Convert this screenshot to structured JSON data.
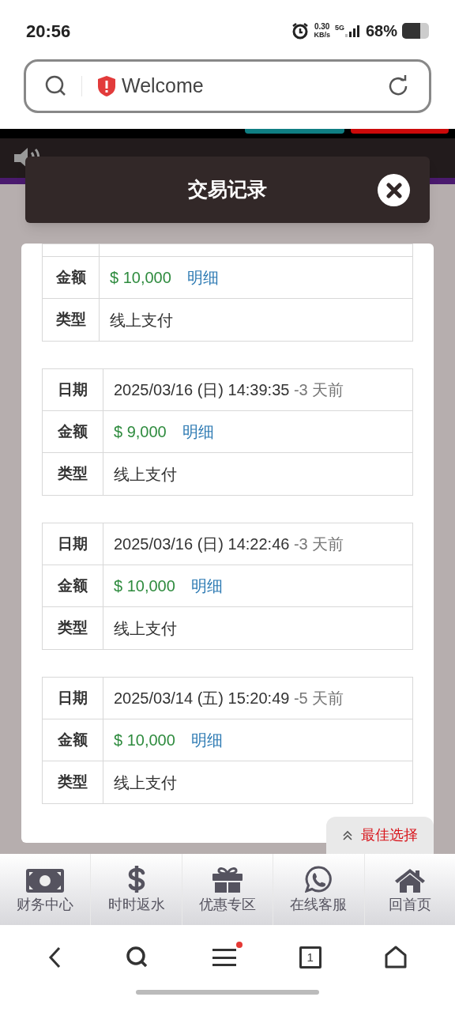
{
  "status_bar": {
    "time": "20:56",
    "speed": "0.30",
    "speed_unit": "KB/s",
    "network": "5G",
    "battery": "68%"
  },
  "address_bar": {
    "title": "Welcome"
  },
  "dialog": {
    "title": "交易记录"
  },
  "records": [
    {
      "partial": true,
      "rows": [
        {
          "kind": "amount",
          "label": "金额",
          "amount": "$ 10,000",
          "link": "明细"
        },
        {
          "kind": "text",
          "label": "类型",
          "value": "线上支付"
        }
      ]
    },
    {
      "partial": false,
      "rows": [
        {
          "kind": "date",
          "label": "日期",
          "value": "2025/03/16 (日) 14:39:35",
          "ago": "-3 天前"
        },
        {
          "kind": "amount",
          "label": "金额",
          "amount": "$ 9,000",
          "link": "明细"
        },
        {
          "kind": "text",
          "label": "类型",
          "value": "线上支付"
        }
      ]
    },
    {
      "partial": false,
      "rows": [
        {
          "kind": "date",
          "label": "日期",
          "value": "2025/03/16 (日) 14:22:46",
          "ago": "-3 天前"
        },
        {
          "kind": "amount",
          "label": "金额",
          "amount": "$ 10,000",
          "link": "明细"
        },
        {
          "kind": "text",
          "label": "类型",
          "value": "线上支付"
        }
      ]
    },
    {
      "partial": false,
      "rows": [
        {
          "kind": "date",
          "label": "日期",
          "value": "2025/03/14 (五) 15:20:49",
          "ago": "-5 天前"
        },
        {
          "kind": "amount",
          "label": "金额",
          "amount": "$ 10,000",
          "link": "明细"
        },
        {
          "kind": "text",
          "label": "类型",
          "value": "线上支付"
        }
      ]
    }
  ],
  "best_choice": {
    "label": "最佳选择"
  },
  "bottom_nav": [
    {
      "kind": "money",
      "label": "财务中心"
    },
    {
      "kind": "dollar",
      "label": "时时返水"
    },
    {
      "kind": "gift",
      "label": "优惠专区"
    },
    {
      "kind": "chat",
      "label": "在线客服"
    },
    {
      "kind": "home",
      "label": "回首页"
    }
  ],
  "browser_bar": {
    "tabs": "1",
    "menu_badge": true
  }
}
